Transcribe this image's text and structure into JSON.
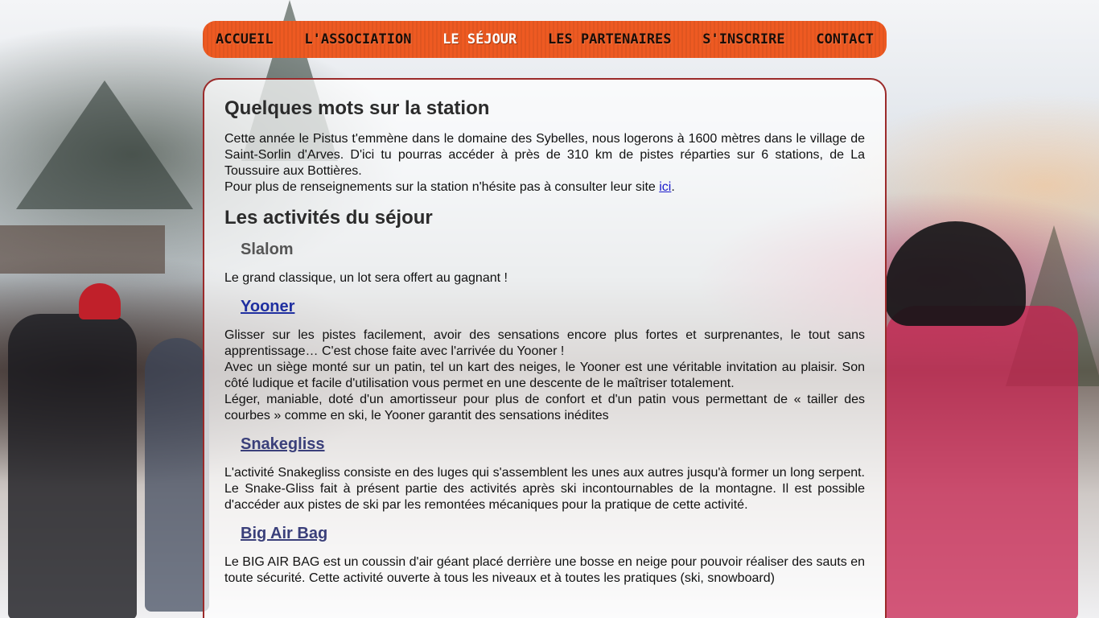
{
  "nav": {
    "items": [
      {
        "label": "ACCUEIL"
      },
      {
        "label": "L'ASSOCIATION"
      },
      {
        "label": "LE SÉJOUR"
      },
      {
        "label": "LES PARTENAIRES"
      },
      {
        "label": "S'INSCRIRE"
      },
      {
        "label": "CONTACT"
      }
    ],
    "active_index": 2
  },
  "station": {
    "title": "Quelques mots sur la station",
    "text_1": "Cette année le Pistus t'emmène dans le domaine des Sybelles, nous logerons à 1600 mètres dans le village de Saint-Sorlin d'Arves. D'ici tu pourras accéder à près de 310 km de pistes réparties sur 6 stations, de La Toussuire aux Bottières.",
    "text_2_before": "Pour plus de renseignements sur la station n'hésite pas à consulter leur site ",
    "link": "ici",
    "text_2_after": "."
  },
  "activities": {
    "title": "Les activités du séjour",
    "items": [
      {
        "name": "Slalom",
        "paragraphs": [
          "Le grand classique, un lot sera offert au gagnant !"
        ]
      },
      {
        "name": "Yooner",
        "paragraphs": [
          "Glisser sur les pistes facilement, avoir des sensations encore plus fortes et surprenantes, le tout sans apprentissage… C'est chose faite avec l'arrivée du Yooner !",
          "Avec un siège monté sur un patin, tel un kart des neiges, le Yooner est une véritable invitation au plaisir. Son côté ludique et facile d'utilisation vous permet en une descente de le maîtriser totalement.",
          "Léger, maniable, doté d'un amortisseur pour plus de confort et d'un patin vous permettant de « tailler des courbes » comme en ski, le Yooner garantit des sensations inédites"
        ]
      },
      {
        "name": "Snakegliss",
        "paragraphs": [
          "L'activité Snakegliss consiste en des luges qui s'assemblent les unes aux autres jusqu'à former un long serpent. Le Snake-Gliss fait à présent partie des activités après ski incontournables de la montagne. Il est possible d'accéder aux pistes de ski par les remontées mécaniques pour la pratique de cette activité."
        ]
      },
      {
        "name": "Big Air Bag",
        "paragraphs": [
          "Le BIG AIR BAG est un coussin d'air géant placé derrière une bosse en neige pour pouvoir réaliser des sauts en toute sécurité. Cette activité ouverte à tous les niveaux et à toutes les pratiques (ski, snowboard)"
        ]
      }
    ]
  },
  "colors": {
    "nav_bg": "#ee5a22",
    "content_border": "#9b2a2a",
    "link": "#1a1acc"
  }
}
